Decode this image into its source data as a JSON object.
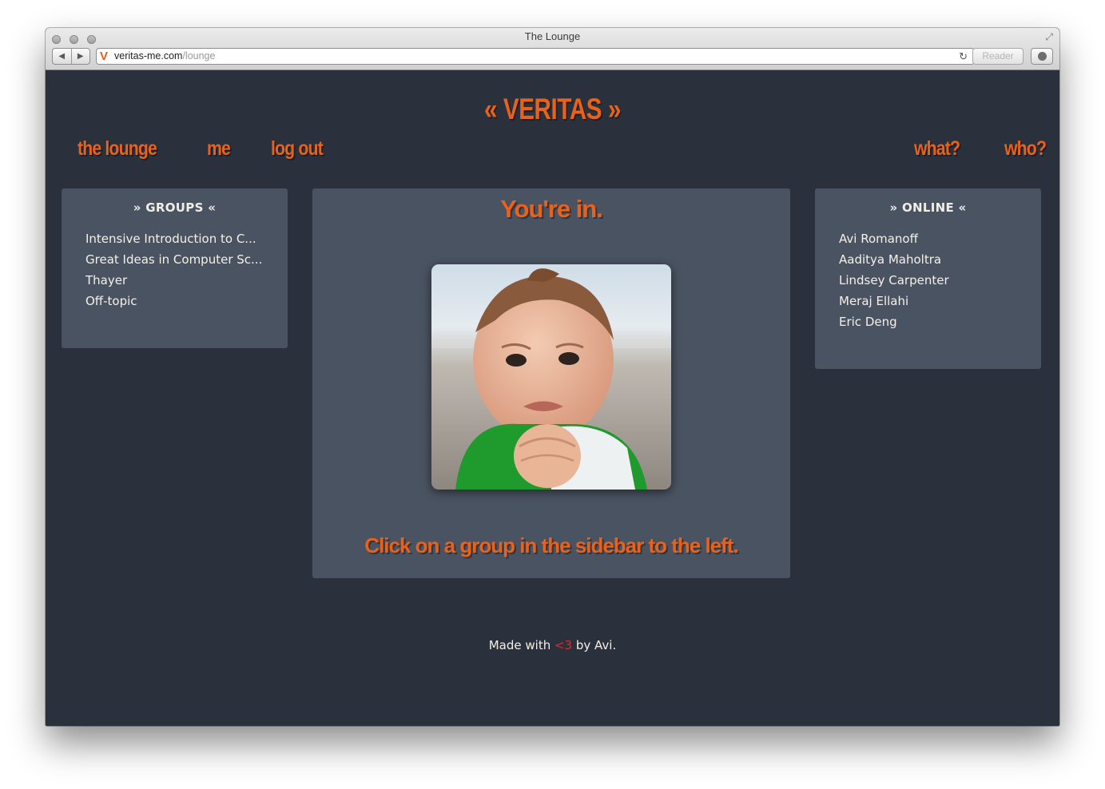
{
  "browser": {
    "window_title": "The Lounge",
    "url_host": "veritas-me.com",
    "url_path": "/lounge",
    "reader_label": "Reader",
    "favicon_letter": "V"
  },
  "site": {
    "logo": "« VERITAS »",
    "nav_left": [
      "the lounge",
      "me",
      "log out"
    ],
    "nav_right": [
      "what?",
      "who?"
    ]
  },
  "groups": {
    "heading": "» GROUPS «",
    "items": [
      "Intensive Introduction to C...",
      "Great Ideas in Computer Sc...",
      "Thayer",
      "Off-topic"
    ]
  },
  "main": {
    "title": "You're in.",
    "image_alt": "baby with clenched fist",
    "hint": "Click on a group in the sidebar to the left."
  },
  "online": {
    "heading": "» ONLINE «",
    "users": [
      "Avi Romanoff",
      "Aaditya Maholtra",
      "Lindsey Carpenter",
      "Meraj Ellahi",
      "Eric Deng"
    ]
  },
  "footer": {
    "prefix": "Made with ",
    "heart": "<3",
    "suffix": " by Avi."
  },
  "colors": {
    "background": "#2b313c",
    "panel": "#4a5362",
    "accent": "#e9621c",
    "text": "#f5f1e6",
    "heart": "#e02a2a"
  }
}
